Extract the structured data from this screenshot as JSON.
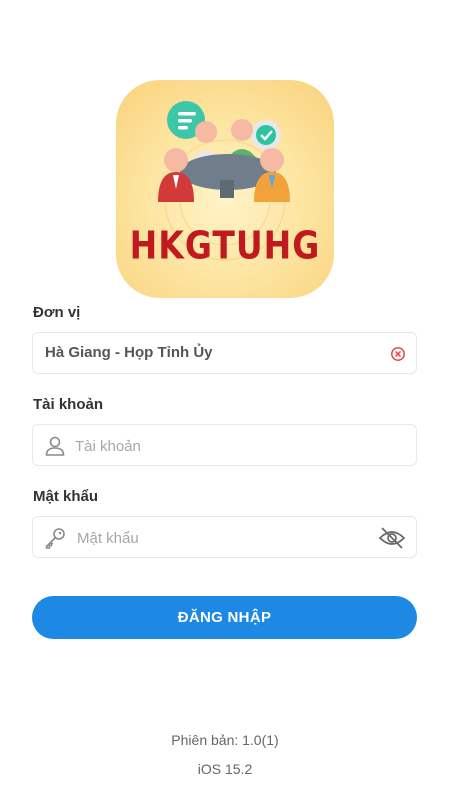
{
  "logo": {
    "brand_text": "HKGTUHG",
    "icon": "meeting-table-icon"
  },
  "unit": {
    "label": "Đơn vị",
    "value": "Hà Giang - Họp Tỉnh Ủy",
    "clear_icon": "clear-circle-icon"
  },
  "account": {
    "label": "Tài khoản",
    "placeholder": "Tài khoản",
    "icon": "user-icon"
  },
  "password": {
    "label": "Mật khẩu",
    "placeholder": "Mật khẩu",
    "icon": "key-icon",
    "toggle_icon": "eye-off-icon"
  },
  "login_button": {
    "label": "ĐĂNG NHẬP"
  },
  "footer": {
    "version": "Phiên bản: 1.0(1)",
    "os": "iOS 15.2"
  },
  "colors": {
    "primary": "#1e88e5",
    "brand_red": "#c0191f",
    "clear_red": "#e53935"
  }
}
